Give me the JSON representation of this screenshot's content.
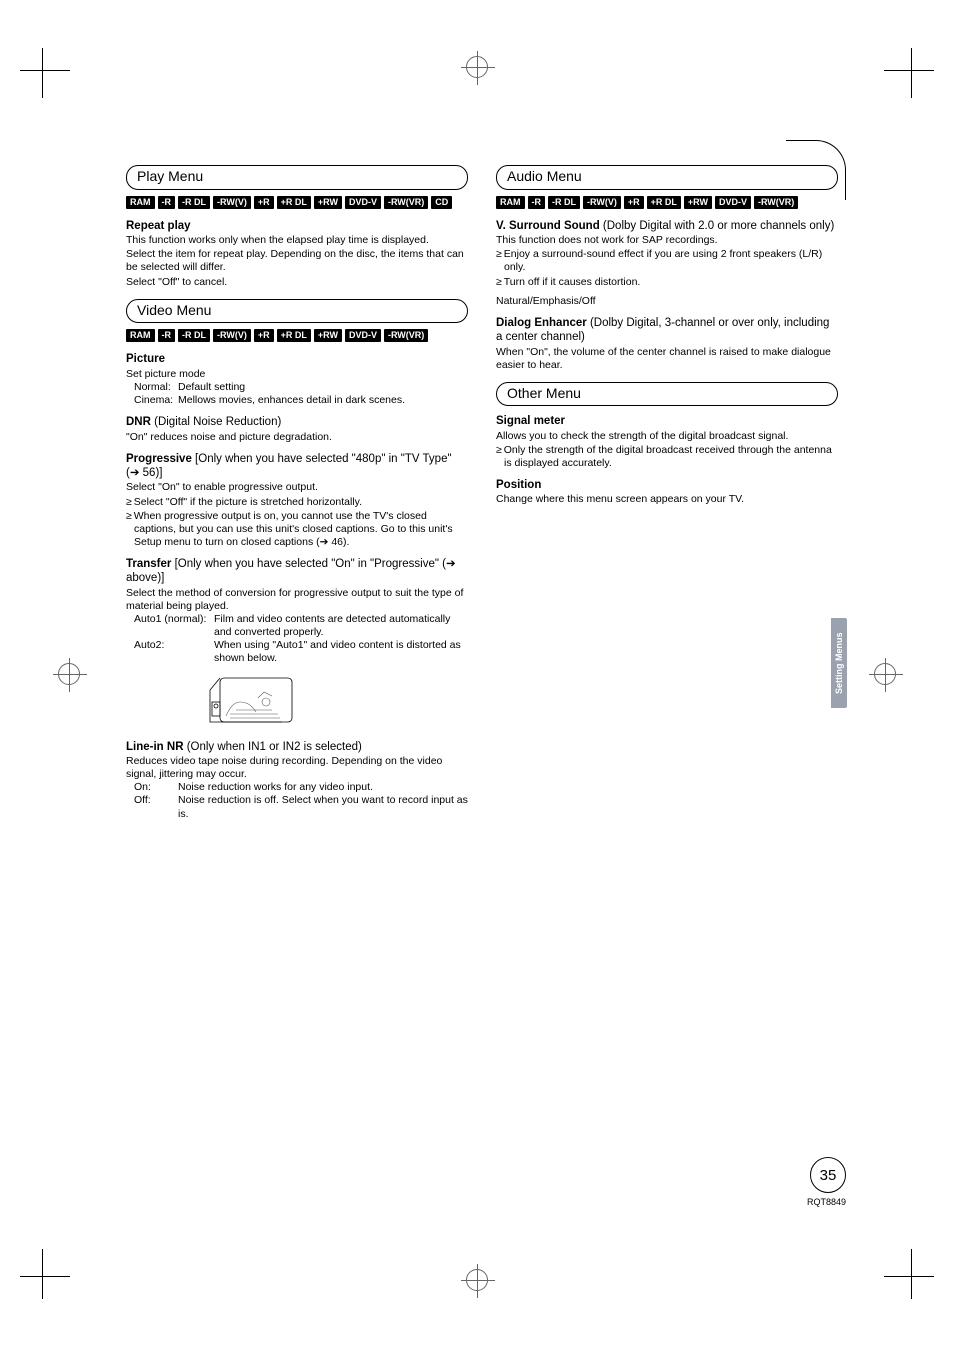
{
  "tagset1": [
    "RAM",
    "-R",
    "-R DL",
    "-RW(V)",
    "+R",
    "+R DL",
    "+RW",
    "DVD-V",
    "-RW(VR)",
    "CD"
  ],
  "tagset2": [
    "RAM",
    "-R",
    "-R DL",
    "-RW(V)",
    "+R",
    "+R DL",
    "+RW",
    "DVD-V",
    "-RW(VR)"
  ],
  "play": {
    "title": "Play Menu",
    "repeat_h": "Repeat play",
    "repeat_b1": "This function works only when the elapsed play time is displayed.",
    "repeat_b2": "Select the item for repeat play. Depending on the disc, the items that can be selected will differ.",
    "repeat_b3": "Select \"Off\" to cancel."
  },
  "video": {
    "title": "Video Menu",
    "picture_h": "Picture",
    "picture_b1": "Set picture mode",
    "picture_normal_l": "Normal:",
    "picture_normal_v": "Default setting",
    "picture_cinema_l": "Cinema:",
    "picture_cinema_v": "Mellows movies, enhances detail in dark scenes.",
    "dnr_h": "DNR",
    "dnr_sub": " (Digital Noise Reduction)",
    "dnr_b1": "\"On\" reduces noise and picture degradation.",
    "prog_h": "Progressive",
    "prog_sub": " [Only when you have selected \"480p\" in \"TV Type\" (➔ 56)]",
    "prog_b1": "Select \"On\" to enable progressive output.",
    "prog_b2": "Select \"Off\" if the picture is stretched horizontally.",
    "prog_b3": "When progressive output is on, you cannot use the TV's closed captions, but you can use this unit's closed captions. Go to this unit's Setup menu to turn on closed captions (➔ 46).",
    "trans_h": "Transfer",
    "trans_sub": " [Only when you have selected \"On\" in \"Progressive\" (➔ above)]",
    "trans_b1": "Select the method of conversion for progressive output to suit the type of material being played.",
    "trans_a1_l": "Auto1 (normal):",
    "trans_a1_v": "Film and video contents are detected automatically and converted properly.",
    "trans_a2_l": "Auto2:",
    "trans_a2_v": "When using \"Auto1\" and video content is distorted as shown below.",
    "linein_h": "Line-in NR",
    "linein_sub": " (Only when IN1 or IN2 is selected)",
    "linein_b1": "Reduces video tape noise during recording. Depending on the video signal, jittering may occur.",
    "linein_on_l": "On:",
    "linein_on_v": "Noise reduction works for any video input.",
    "linein_off_l": "Off:",
    "linein_off_v": "Noise reduction is off. Select when you want to record input as is."
  },
  "audio": {
    "title": "Audio Menu",
    "vss_h": "V. Surround Sound",
    "vss_sub": " (Dolby Digital with 2.0 or more channels only)",
    "vss_b1": "This function does not work for SAP recordings.",
    "vss_b2": "Enjoy a surround-sound effect if you are using 2 front speakers (L/R) only.",
    "vss_b3": "Turn off if it causes distortion.",
    "vss_b4": "Natural/Emphasis/Off",
    "de_h": "Dialog Enhancer",
    "de_sub": " (Dolby Digital, 3-channel or over only, including a center channel)",
    "de_b1": "When \"On\", the volume of the center channel is raised to make dialogue easier to hear."
  },
  "other": {
    "title": "Other Menu",
    "sig_h": "Signal meter",
    "sig_b1": "Allows you to check the strength of the digital broadcast signal.",
    "sig_b2": "Only the strength of the digital broadcast received through the antenna is displayed accurately.",
    "pos_h": "Position",
    "pos_b1": "Change where this menu screen appears on your TV."
  },
  "side_tab": "Setting Menus",
  "page_num": "35",
  "doc_code": "RQT8849"
}
